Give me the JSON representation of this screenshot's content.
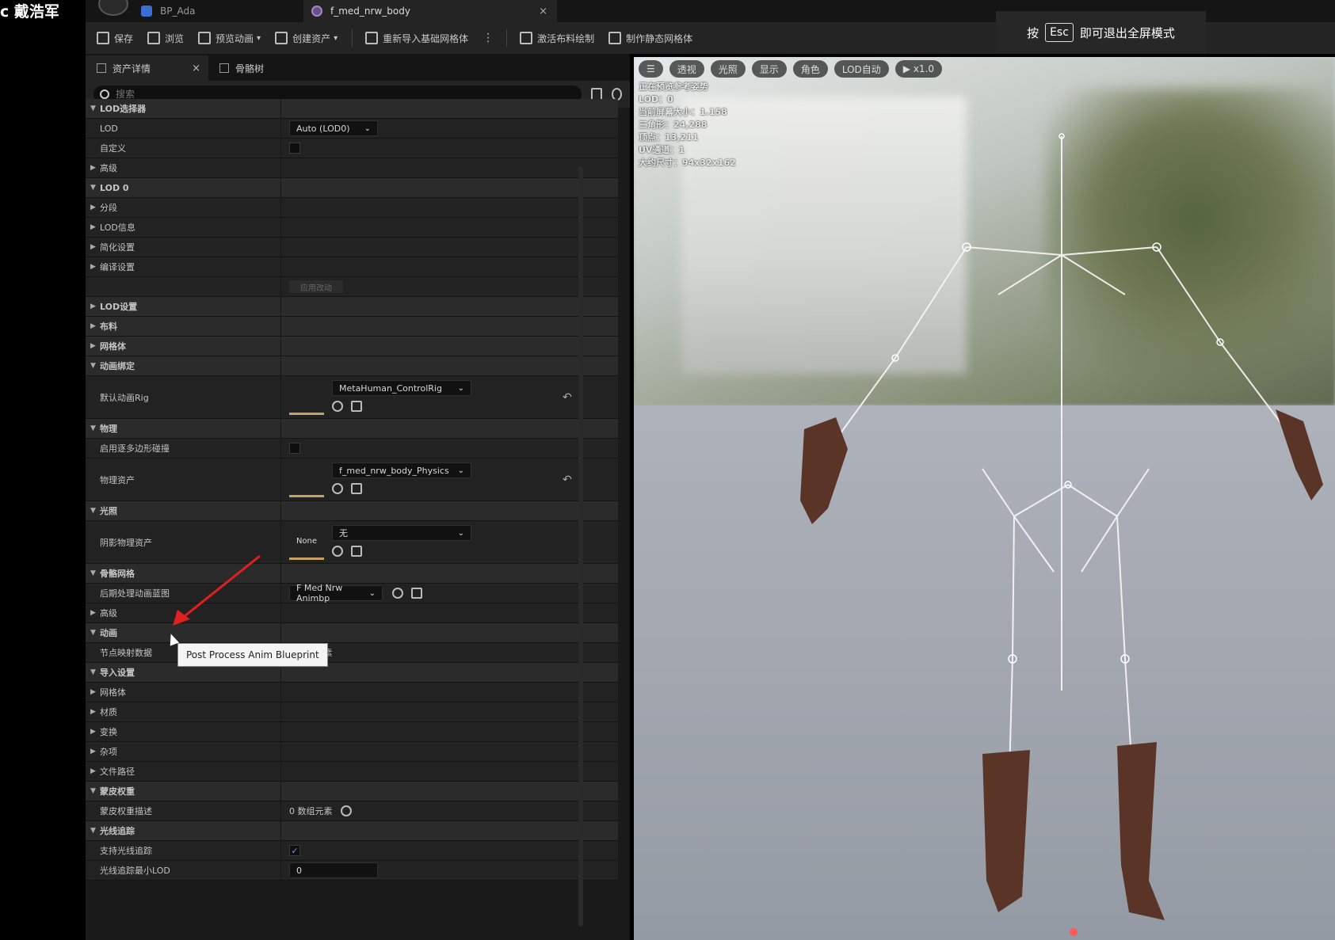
{
  "watermark": "c 戴浩军",
  "titlebar": {
    "tabs": [
      {
        "label": "BP_Ada"
      },
      {
        "label": "f_med_nrw_body",
        "close": "×"
      }
    ]
  },
  "toolbar": {
    "save": "保存",
    "browse": "浏览",
    "preview_anim": "预览动画",
    "create_asset": "创建资产",
    "reimport": "重新导入基础网格体",
    "activate_cloth": "激活布料绘制",
    "make_static": "制作静态网格体"
  },
  "fullscreen_hint": {
    "before": "按",
    "key": "Esc",
    "after": "即可退出全屏模式"
  },
  "panel": {
    "tabs": [
      {
        "label": "资产详情",
        "close": "×"
      },
      {
        "label": "骨骼树"
      }
    ],
    "search_placeholder": "搜索",
    "rows": [
      {
        "kind": "cat",
        "label": "LOD选择器",
        "expanded": true
      },
      {
        "kind": "prop",
        "label": "LOD",
        "value": "Auto (LOD0)"
      },
      {
        "kind": "prop",
        "label": "自定义",
        "checkbox": false
      },
      {
        "kind": "sub",
        "label": "高级"
      },
      {
        "kind": "cat",
        "label": "LOD 0",
        "expanded": true
      },
      {
        "kind": "sub",
        "label": "分段"
      },
      {
        "kind": "sub",
        "label": "LOD信息"
      },
      {
        "kind": "sub",
        "label": "简化设置"
      },
      {
        "kind": "sub",
        "label": "编译设置"
      },
      {
        "kind": "button",
        "value": "应用改动"
      },
      {
        "kind": "cat",
        "label": "LOD设置"
      },
      {
        "kind": "cat",
        "label": "布料"
      },
      {
        "kind": "cat",
        "label": "网格体"
      },
      {
        "kind": "cat",
        "label": "动画绑定",
        "expanded": true
      },
      {
        "kind": "asset",
        "label": "默认动画Rig",
        "value": "MetaHuman_ControlRig"
      },
      {
        "kind": "cat",
        "label": "物理",
        "expanded": true
      },
      {
        "kind": "prop",
        "label": "启用逐多边形碰撞",
        "checkbox": false
      },
      {
        "kind": "asset",
        "label": "物理资产",
        "value": "f_med_nrw_body_Physics"
      },
      {
        "kind": "cat",
        "label": "光照",
        "expanded": true
      },
      {
        "kind": "asset",
        "label": "阴影物理资产",
        "value": "无",
        "thumb": "None"
      },
      {
        "kind": "cat",
        "label": "骨骼网格",
        "expanded": true
      },
      {
        "kind": "prop",
        "label": "后期处理动画蓝图",
        "value": "F Med Nrw Animbp"
      },
      {
        "kind": "sub",
        "label": "高级"
      },
      {
        "kind": "cat",
        "label": "动画",
        "expanded": true
      },
      {
        "kind": "prop",
        "label": "节点映射数据",
        "value": "0 数组元素"
      },
      {
        "kind": "cat",
        "label": "导入设置",
        "expanded": true
      },
      {
        "kind": "sub",
        "label": "网格体"
      },
      {
        "kind": "sub",
        "label": "材质"
      },
      {
        "kind": "sub",
        "label": "变换"
      },
      {
        "kind": "sub",
        "label": "杂项"
      },
      {
        "kind": "sub",
        "label": "文件路径"
      },
      {
        "kind": "cat",
        "label": "蒙皮权重",
        "expanded": true
      },
      {
        "kind": "prop",
        "label": "蒙皮权重描述",
        "value": "0 数组元素"
      },
      {
        "kind": "cat",
        "label": "光线追踪",
        "expanded": true
      },
      {
        "kind": "prop",
        "label": "支持光线追踪",
        "checkbox": true
      },
      {
        "kind": "prop",
        "label": "光线追踪最小LOD",
        "value": "0"
      }
    ],
    "tooltip": "Post Process Anim Blueprint"
  },
  "viewport": {
    "toolbar": [
      "透视",
      "光照",
      "显示",
      "角色",
      "LOD自动",
      "x1.0"
    ],
    "stats": [
      "正在预览参考姿势",
      "LOD：0",
      "当前屏幕大小：1.158",
      "三角形：24,288",
      "顶点：13,211",
      "UV通道：1",
      "大约尺寸：94x32x162"
    ]
  },
  "colors": {
    "accent": "#c8a060",
    "checkbox_on": "#5fa0ff",
    "arrow": "#e02020"
  }
}
